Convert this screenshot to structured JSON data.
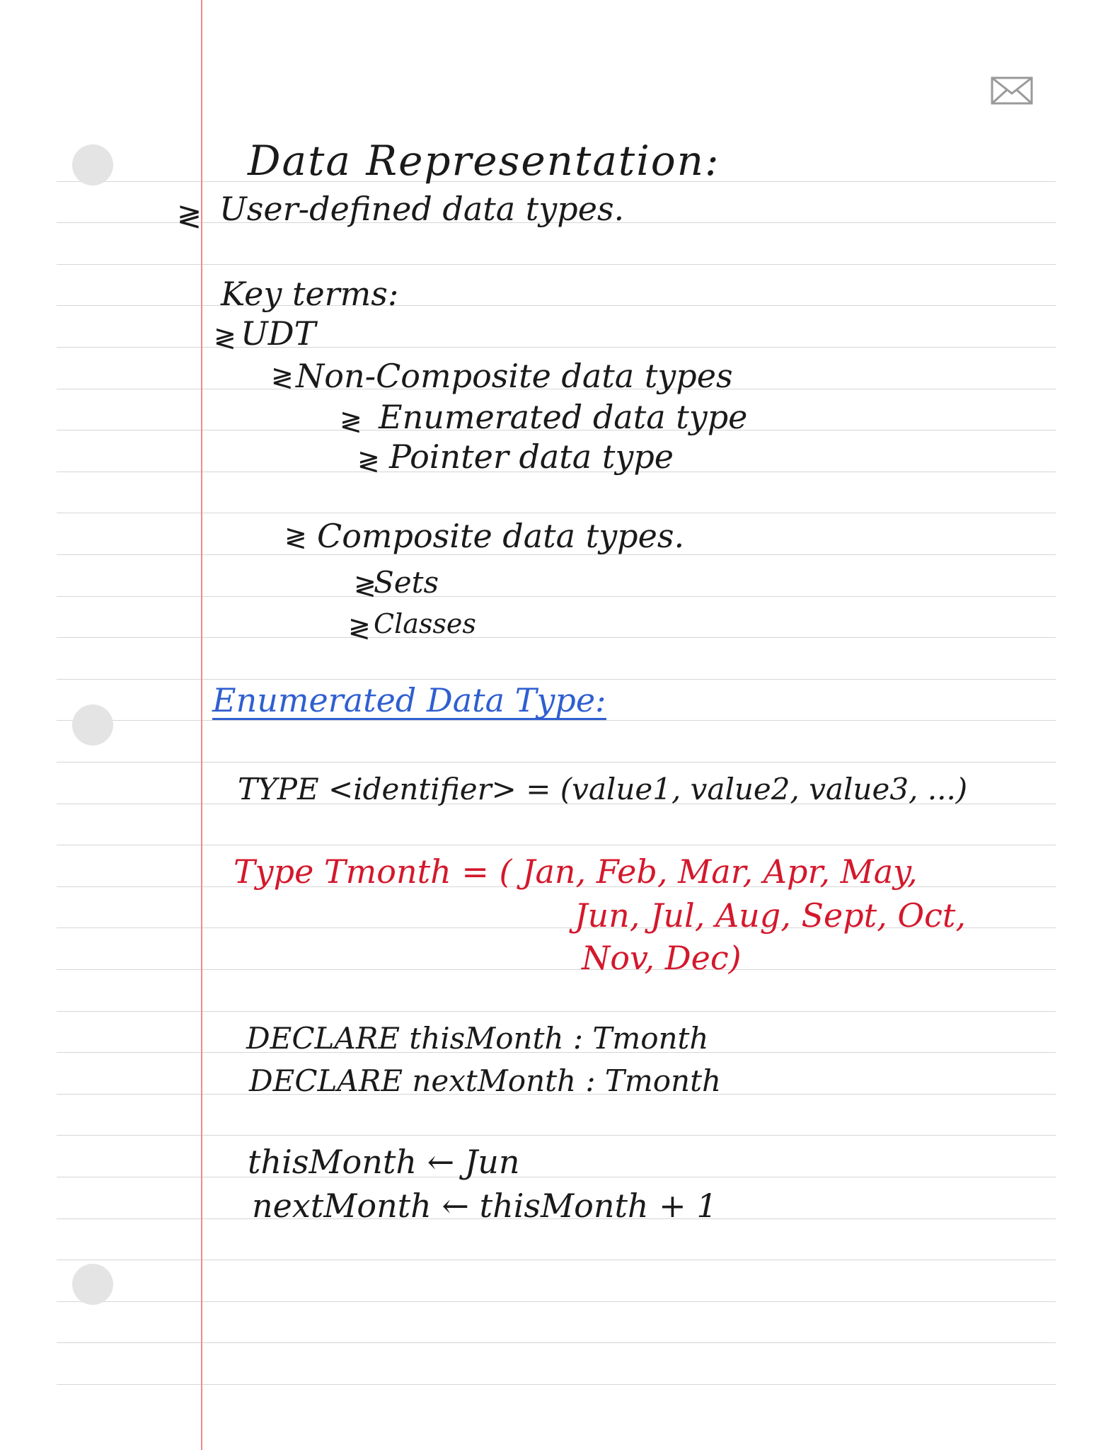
{
  "notes": {
    "title": "Data Representation:",
    "subtitle": "User-defined data types.",
    "key_terms_heading": "Key terms:",
    "bullet_glyph": "≷",
    "udt": "UDT",
    "non_composite": "Non-Composite data types",
    "enumerated": "Enumerated data type",
    "pointer": "Pointer data type",
    "composite": "Composite data types.",
    "sets": "Sets",
    "classes": "Classes",
    "enum_heading": "Enumerated Data Type:",
    "type_syntax": "TYPE <identifier> = (value1, value2, value3, ...)",
    "tmonth_line1": "Type  Tmonth  =  ( Jan, Feb, Mar, Apr, May,",
    "tmonth_line2": "Jun, Jul, Aug, Sept, Oct,",
    "tmonth_line3": "Nov, Dec)",
    "declare1": "DECLARE  thisMonth  :  Tmonth",
    "declare2": "DECLARE  nextMonth  :  Tmonth",
    "assign1": "thisMonth ← Jun",
    "assign2": "nextMonth ← thisMonth + 1"
  },
  "colors": {
    "ink": "#1a1a1a",
    "blue_ink": "#2f5fd0",
    "red_ink": "#d4182c",
    "margin_line": "#ec8c8c",
    "rule_line": "#d6d6d6"
  },
  "icons": {
    "mail": "envelope-icon"
  }
}
